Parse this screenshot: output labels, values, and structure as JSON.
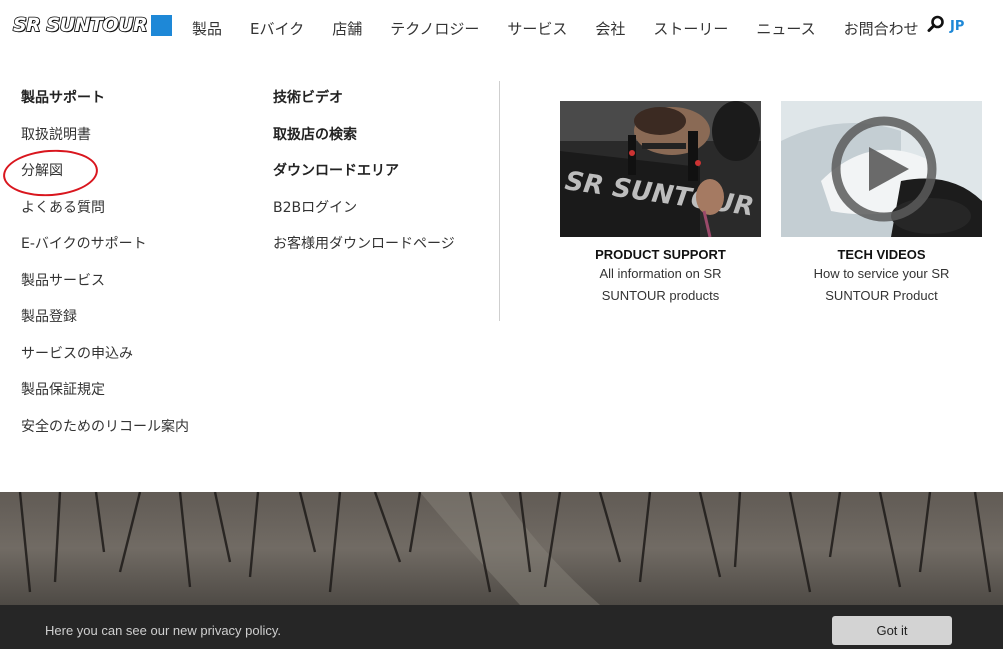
{
  "header": {
    "logo_text": "SR SUNTOUR",
    "nav": [
      "製品",
      "Eバイク",
      "店舗",
      "テクノロジー",
      "サービス",
      "会社",
      "ストーリー",
      "ニュース",
      "お問合わせ"
    ],
    "lang": "JP"
  },
  "menu": {
    "column1": [
      {
        "label": "製品サポート",
        "bold": true
      },
      {
        "label": "取扱説明書"
      },
      {
        "label": "分解図"
      },
      {
        "label": "よくある質問"
      },
      {
        "label": "E-バイクのサポート"
      },
      {
        "label": "製品サービス"
      },
      {
        "label": "製品登録"
      },
      {
        "label": "サービスの申込み"
      },
      {
        "label": "製品保証規定"
      },
      {
        "label": "安全のためのリコール案内"
      }
    ],
    "column2": [
      {
        "label": "技術ビデオ",
        "bold": true
      },
      {
        "label": "取扱店の検索",
        "bold": true
      },
      {
        "label": "ダウンロードエリア",
        "bold": true
      },
      {
        "label": "B2Bログイン"
      },
      {
        "label": "お客様用ダウンロードページ"
      }
    ],
    "cards": [
      {
        "title": "PRODUCT SUPPORT",
        "desc": "All information on SR SUNTOUR products",
        "banner_text": "SR SUNTOUR"
      },
      {
        "title": "TECH VIDEOS",
        "desc": "How to service your SR SUNTOUR Product"
      }
    ]
  },
  "privacy": {
    "text": "Here you can see our new privacy policy.",
    "button": "Got it"
  },
  "colors": {
    "accent": "#1e88d7",
    "highlight_circle": "#d9161e",
    "privacy_bg": "#262626"
  }
}
